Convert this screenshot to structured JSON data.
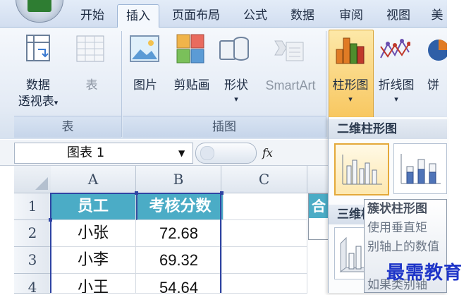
{
  "tabs": [
    {
      "label": "开始",
      "active": false
    },
    {
      "label": "插入",
      "active": true
    },
    {
      "label": "页面布局",
      "active": false
    },
    {
      "label": "公式",
      "active": false
    },
    {
      "label": "数据",
      "active": false
    },
    {
      "label": "审阅",
      "active": false
    },
    {
      "label": "视图",
      "active": false
    },
    {
      "label": "美",
      "active": false
    }
  ],
  "ribbon": {
    "pivot": {
      "line1": "数据",
      "line2": "透视表",
      "arrow": "▾"
    },
    "table": "表",
    "picture": "图片",
    "clipart": "剪贴画",
    "shapes": "形状",
    "shapes_arrow": "▾",
    "smartart": "SmartArt",
    "column_chart": "柱形图",
    "column_arrow": "▾",
    "line_chart": "折线图",
    "line_arrow": "▾",
    "pie_chart": "饼",
    "groups": {
      "tables": "表",
      "illustrations": "插图"
    }
  },
  "formula_bar": {
    "name_box": "图表 1",
    "name_arrow": "▼",
    "fx": "fx"
  },
  "grid": {
    "columns": [
      "A",
      "B",
      "C"
    ],
    "rows": [
      "1",
      "2",
      "3",
      "4"
    ],
    "header": [
      "员工",
      "考核分数"
    ],
    "data": [
      [
        "小张",
        "72.68"
      ],
      [
        "小李",
        "69.32"
      ],
      [
        "小王",
        "54.64"
      ]
    ],
    "cut_cell": "合"
  },
  "dropdown": {
    "section1": "二维柱形图",
    "section2": "三维柱形图",
    "tooltip_lines": [
      "簇状柱形图",
      "使用垂直矩",
      "别轴上的数值",
      "",
      "如果类别轴"
    ]
  },
  "watermark": "最需教育",
  "colors": {
    "header_fill": "#4bacc6",
    "highlight": "#f8c760",
    "watermark": "#1e35c8"
  }
}
